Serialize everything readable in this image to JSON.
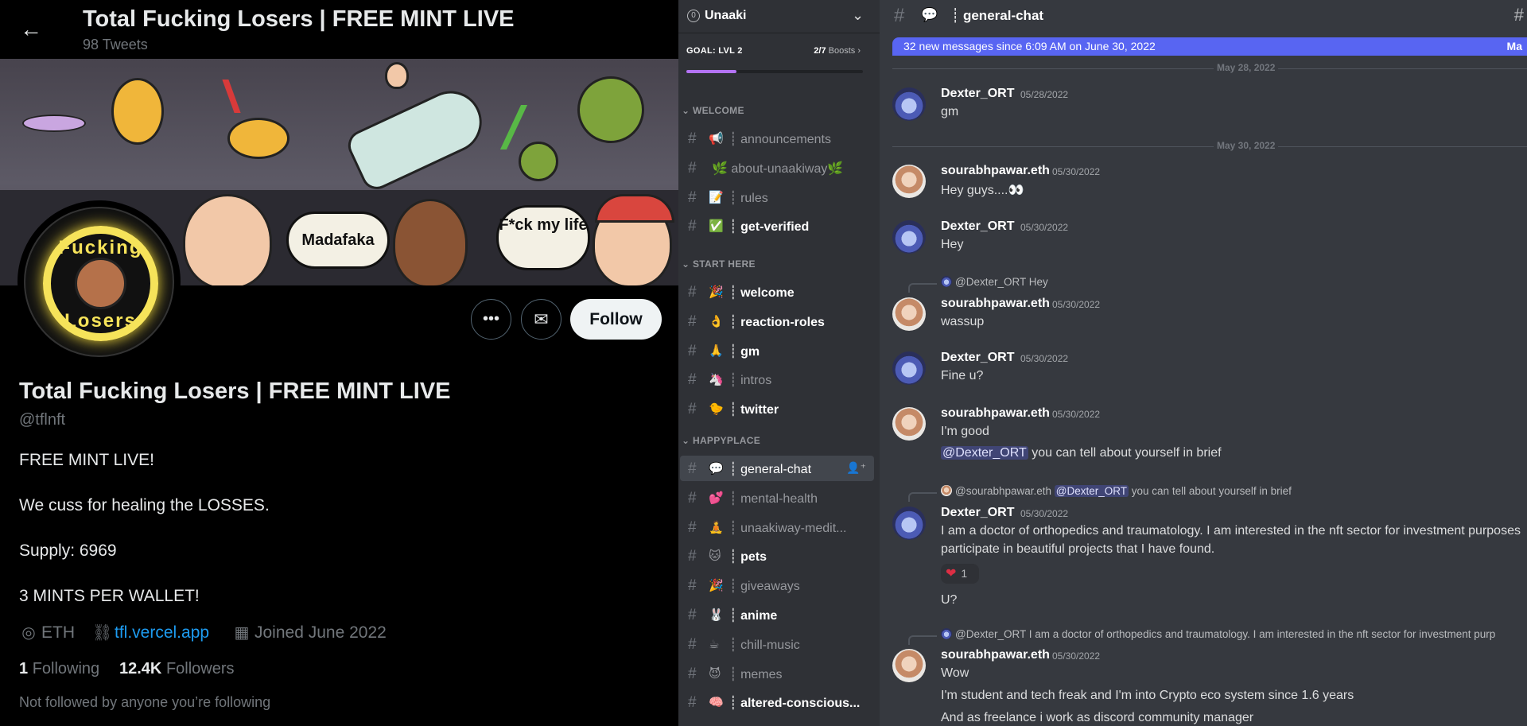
{
  "twitter": {
    "header": {
      "name": "Total Fucking Losers | FREE MINT LIVE",
      "tweets_count": "98 Tweets"
    },
    "banner": {
      "bubble1": "Madafaka",
      "bubble2": "F*ck my life"
    },
    "avatar": {
      "text_top": "Fucking",
      "text_bottom": "Losers"
    },
    "profile": {
      "name": "Total Fucking Losers | FREE MINT LIVE",
      "handle": "@tflnft",
      "bio": [
        "FREE MINT LIVE!",
        "We cuss for healing the LOSSES.",
        "Supply: 6969",
        "3 MINTS PER WALLET!"
      ],
      "location": "ETH",
      "website": "tfl.vercel.app",
      "joined": "Joined June 2022",
      "following_count": "1",
      "following_label": "Following",
      "followers_count": "12.4K",
      "followers_label": "Followers",
      "not_followed": "Not followed by anyone you’re following"
    },
    "follow_label": "Follow"
  },
  "discord": {
    "server": {
      "name": "Unaaki",
      "goal_label": "GOAL: LVL 2",
      "goal_count": "2/7",
      "goal_unit": "Boosts",
      "goal_progress": 0.286
    },
    "categories": [
      {
        "name": "WELCOME",
        "channels": [
          {
            "emoji": "📢",
            "label": "announcements",
            "unread": false
          },
          {
            "emoji": "",
            "label": "🌿 about-unaakiway🌿",
            "unread": false
          },
          {
            "emoji": "📝",
            "label": "rules",
            "unread": false
          },
          {
            "emoji": "✅",
            "label": "get-verified",
            "unread": true
          }
        ]
      },
      {
        "name": "START HERE",
        "channels": [
          {
            "emoji": "🎉",
            "label": "welcome",
            "unread": true
          },
          {
            "emoji": "👌",
            "label": "reaction-roles",
            "unread": true
          },
          {
            "emoji": "🙏",
            "label": "gm",
            "unread": true
          },
          {
            "emoji": "🦄",
            "label": "intros",
            "unread": false
          },
          {
            "emoji": "🐤",
            "label": "twitter",
            "unread": true
          }
        ]
      },
      {
        "name": "HAPPYPLACE",
        "channels": [
          {
            "emoji": "💬",
            "label": "general-chat",
            "unread": false,
            "selected": true
          },
          {
            "emoji": "💕",
            "label": "mental-health",
            "unread": false
          },
          {
            "emoji": "🧘",
            "label": "unaakiway-medit...",
            "unread": false
          },
          {
            "emoji": "🐱",
            "label": "pets",
            "unread": true
          },
          {
            "emoji": "🎉",
            "label": "giveaways",
            "unread": false
          },
          {
            "emoji": "🐰",
            "label": "anime",
            "unread": true
          },
          {
            "emoji": "☕",
            "label": "chill-music",
            "unread": false
          },
          {
            "emoji": "😈",
            "label": "memes",
            "unread": false
          },
          {
            "emoji": "🧠",
            "label": "altered-conscious...",
            "unread": true
          }
        ]
      }
    ],
    "chat": {
      "channel": "general-chat",
      "new_messages": "32 new messages since 6:09 AM on June 30, 2022",
      "new_messages_right": "Ma",
      "date1": "May 28, 2022",
      "date2": "May 30, 2022",
      "messages": [
        {
          "author": "Dexter_ORT",
          "time": "05/28/2022",
          "lines": [
            "gm"
          ]
        },
        {
          "author": "sourabhpawar.eth",
          "time": "05/30/2022",
          "lines": [
            "Hey guys....👀"
          ]
        },
        {
          "author": "Dexter_ORT",
          "time": "05/30/2022",
          "lines": [
            "Hey"
          ]
        },
        {
          "reply_to": "@Dexter_ORT",
          "reply_text": "Hey",
          "author": "sourabhpawar.eth",
          "time": "05/30/2022",
          "lines": [
            "wassup"
          ]
        },
        {
          "author": "Dexter_ORT",
          "time": "05/30/2022",
          "lines": [
            "Fine u?"
          ]
        },
        {
          "author": "sourabhpawar.eth",
          "time": "05/30/2022",
          "lines": [
            "I'm good"
          ],
          "mention": "@Dexter_ORT",
          "mention_tail": "you can tell about yourself in brief"
        },
        {
          "reply_to": "@sourabhpawar.eth",
          "reply_mention": "@Dexter_ORT",
          "reply_text": "you can tell about yourself in brief",
          "author": "Dexter_ORT",
          "time": "05/30/2022",
          "lines": [
            "I am a doctor of orthopedics and traumatology. I am interested in the nft sector for investment purposes",
            "participate in beautiful projects that I have found."
          ],
          "reaction": {
            "emoji": "❤️",
            "count": "1"
          },
          "after": "U?"
        },
        {
          "reply_to": "@Dexter_ORT",
          "reply_text": "I am a doctor of orthopedics and traumatology. I am interested in the nft sector for investment purp",
          "author": "sourabhpawar.eth",
          "time": "05/30/2022",
          "lines": [
            "Wow",
            "I'm student and tech freak and I'm into Crypto eco system since 1.6 years",
            "And as freelance i work as discord community manager"
          ]
        }
      ]
    }
  }
}
